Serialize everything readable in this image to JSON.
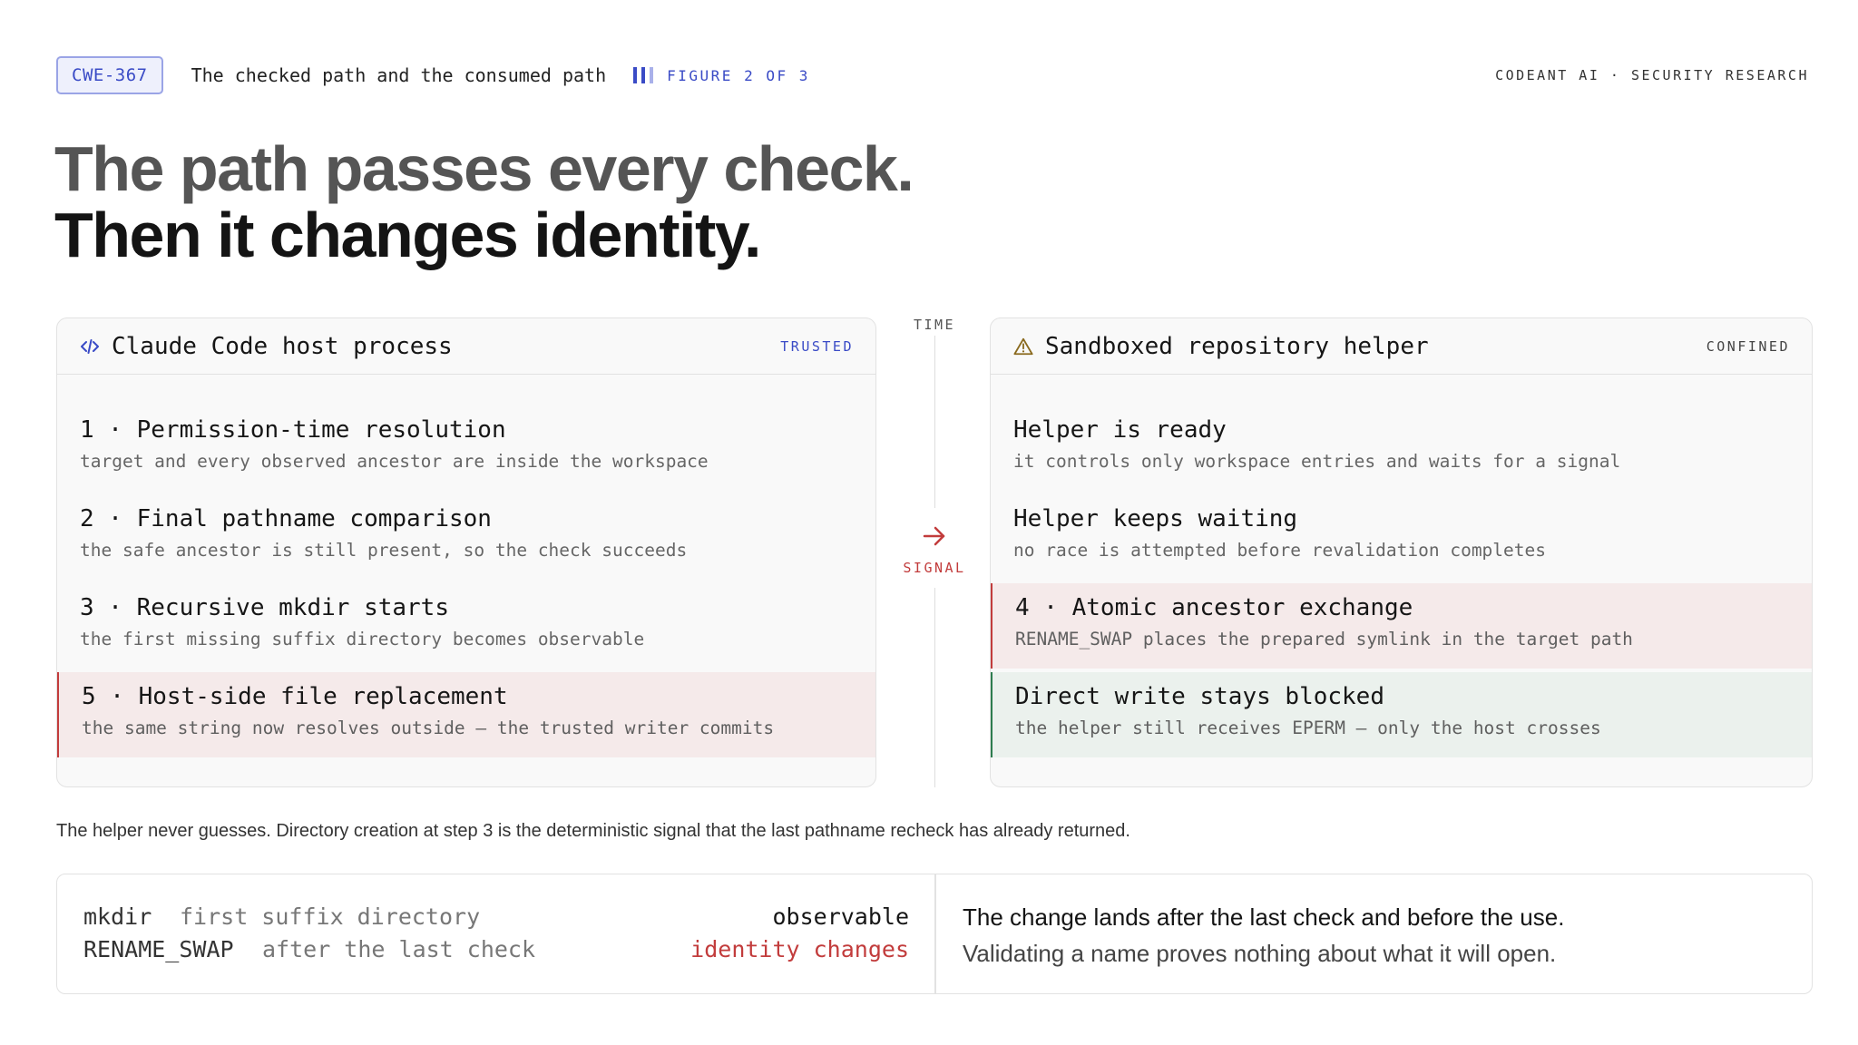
{
  "header": {
    "tag": "CWE-367",
    "subtitle": "The checked path and the consumed path",
    "figure": "FIGURE 2 OF 3",
    "brand": "CODEANT AI · SECURITY RESEARCH"
  },
  "headline": {
    "line1": "The path passes every check.",
    "line2": "Then it changes identity."
  },
  "left_panel": {
    "title": "Claude Code host process",
    "badge": "TRUSTED",
    "icon": "code-icon",
    "steps": [
      {
        "title": "1 · Permission-time resolution",
        "desc": "target and every observed ancestor are inside the workspace"
      },
      {
        "title": "2 · Final pathname comparison",
        "desc": "the safe ancestor is still present, so the check succeeds"
      },
      {
        "title": "3 · Recursive mkdir starts",
        "desc": "the first missing suffix directory becomes observable"
      },
      {
        "title": "5 · Host-side file replacement",
        "desc": "the same string now resolves outside — the trusted writer commits",
        "highlight": "red"
      }
    ]
  },
  "right_panel": {
    "title": "Sandboxed repository helper",
    "badge": "CONFINED",
    "icon": "warning-icon",
    "steps": [
      {
        "title": "Helper is ready",
        "desc": "it controls only workspace entries and waits for a signal"
      },
      {
        "title": "Helper keeps waiting",
        "desc": "no race is attempted before revalidation completes"
      },
      {
        "title": "4 · Atomic ancestor exchange",
        "desc": "RENAME_SWAP places the prepared symlink in the target path",
        "highlight": "red"
      },
      {
        "title": "Direct write stays blocked",
        "desc": "the helper still receives EPERM — only the host crosses",
        "highlight": "green"
      }
    ]
  },
  "timeline": {
    "time_label": "TIME",
    "signal_label": "SIGNAL",
    "signal_icon": "arrow-right-icon"
  },
  "caption": "The helper never guesses. Directory creation at step 3 is the deterministic signal that the last pathname recheck has already returned.",
  "bottom": {
    "rows": [
      {
        "key": "mkdir",
        "value": "first suffix directory",
        "result": "observable"
      },
      {
        "key": "RENAME_SWAP",
        "value": "after the last check",
        "result": "identity changes"
      }
    ],
    "statement": "The change lands after the last check and before the use.",
    "note": "Validating a name proves nothing about what it will open."
  },
  "colors": {
    "accent_blue": "#3a4bc6",
    "alert_red": "#c23c3c",
    "safe_green": "#2e7d4f",
    "warning_amber": "#8a6a1e"
  }
}
